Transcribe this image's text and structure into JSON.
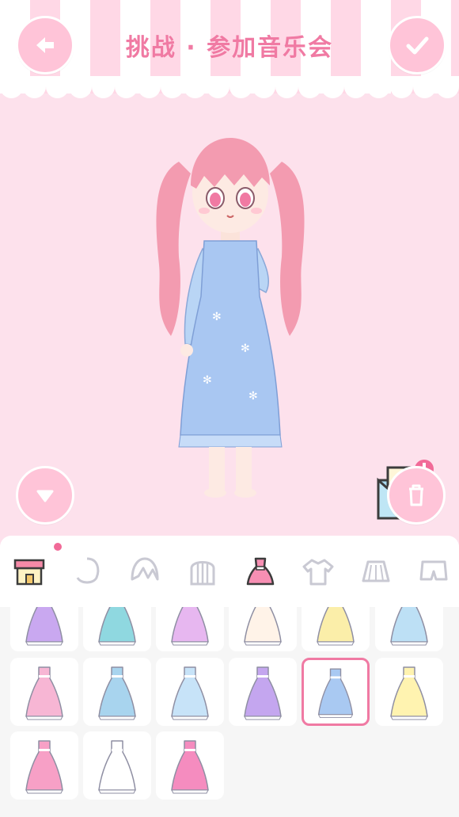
{
  "header": {
    "title": "挑战 · 参加音乐会"
  },
  "icons": {
    "back": "arrow-left-icon",
    "confirm": "checkmark-icon",
    "collapse": "triangle-down-icon",
    "delete": "trash-icon",
    "mail": "love-letter-icon"
  },
  "categories": [
    {
      "name": "shop",
      "icon": "shop-icon",
      "active": false,
      "badge": true
    },
    {
      "name": "face",
      "icon": "face-icon",
      "active": false
    },
    {
      "name": "bangs",
      "icon": "bangs-icon",
      "active": false
    },
    {
      "name": "back-hair",
      "icon": "back-hair-icon",
      "active": false
    },
    {
      "name": "dress",
      "icon": "dress-icon",
      "active": true
    },
    {
      "name": "top",
      "icon": "shirt-icon",
      "active": false
    },
    {
      "name": "skirt",
      "icon": "skirt-icon",
      "active": false
    },
    {
      "name": "pants",
      "icon": "shorts-icon",
      "active": false
    }
  ],
  "items": [
    {
      "name": "purple-skirt-outfit",
      "color": "#c9a8f0"
    },
    {
      "name": "teal-pleated-outfit",
      "color": "#8fd8e0"
    },
    {
      "name": "lilac-dress",
      "color": "#e7b7f0"
    },
    {
      "name": "white-ruffle-dress",
      "color": "#fff3e8"
    },
    {
      "name": "yellow-dress",
      "color": "#fbeea9"
    },
    {
      "name": "blue-bow-outfit",
      "color": "#bde0f5"
    },
    {
      "name": "pink-striped-dress",
      "color": "#f7b6d4"
    },
    {
      "name": "blue-flower-dress",
      "color": "#a8d4ee"
    },
    {
      "name": "light-blue-dress",
      "color": "#c7e3f8"
    },
    {
      "name": "purple-gradient-gown",
      "color": "#c4a6ef"
    },
    {
      "name": "blue-snowflake-dress",
      "color": "#a9c9f2",
      "selected": true
    },
    {
      "name": "pale-yellow-dress",
      "color": "#fff3b0"
    },
    {
      "name": "pink-princess-gown",
      "color": "#f7a0c6"
    },
    {
      "name": "white-wedding-gown",
      "color": "#ffffff"
    },
    {
      "name": "pink-gradient-gown",
      "color": "#f58cbf"
    }
  ],
  "colors": {
    "accent": "#f07aa3",
    "background": "#fde1ec",
    "button": "#ffc4d8"
  }
}
